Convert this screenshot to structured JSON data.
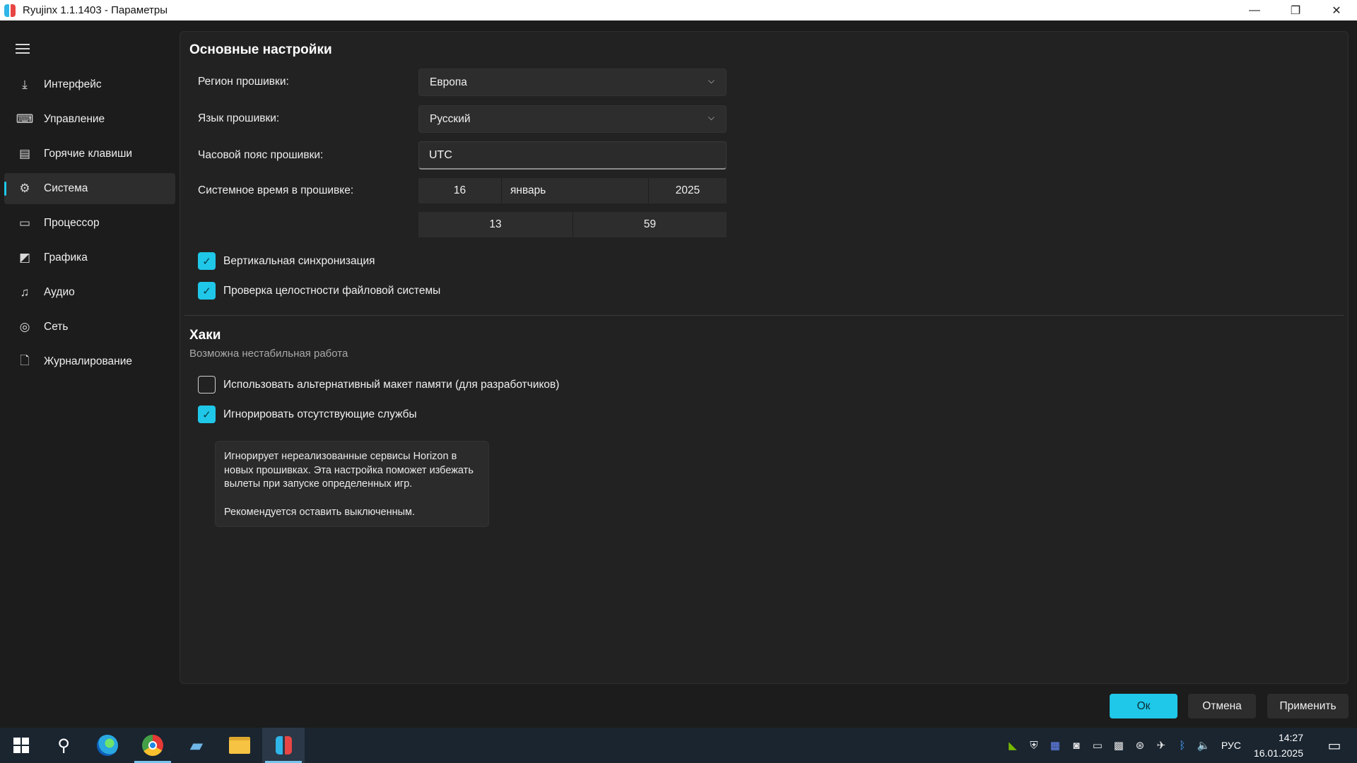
{
  "window": {
    "title": "Ryujinx 1.1.1403 - Параметры",
    "minimize": "—",
    "maximize": "❐",
    "close": "✕"
  },
  "sidebar": {
    "items": [
      {
        "label": "Интерфейс",
        "icon": "interface-icon"
      },
      {
        "label": "Управление",
        "icon": "gamepad-icon"
      },
      {
        "label": "Горячие клавиши",
        "icon": "keyboard-icon"
      },
      {
        "label": "Система",
        "icon": "gear-icon",
        "active": true
      },
      {
        "label": "Процессор",
        "icon": "cpu-icon"
      },
      {
        "label": "Графика",
        "icon": "image-icon"
      },
      {
        "label": "Аудио",
        "icon": "music-icon"
      },
      {
        "label": "Сеть",
        "icon": "globe-icon"
      },
      {
        "label": "Журналирование",
        "icon": "document-icon"
      }
    ]
  },
  "main": {
    "section_title": "Основные настройки",
    "region_label": "Регион прошивки:",
    "region_value": "Европа",
    "language_label": "Язык прошивки:",
    "language_value": "Русский",
    "timezone_label": "Часовой пояс прошивки:",
    "timezone_value": "UTC",
    "systime_label": "Системное время в прошивке:",
    "date_day": "16",
    "date_month": "январь",
    "date_year": "2025",
    "time_hour": "13",
    "time_minute": "59",
    "vsync_label": "Вертикальная синхронизация",
    "vsync_checked": true,
    "fscheck_label": "Проверка целостности файловой системы",
    "fscheck_checked": true
  },
  "hacks": {
    "title": "Хаки",
    "subtitle": "Возможна нестабильная работа",
    "altmem_label": "Использовать альтернативный макет памяти (для разработчиков)",
    "altmem_checked": false,
    "ignore_label": "Игнорировать отсутствующие службы",
    "ignore_checked": true,
    "tooltip_line1": "Игнорирует нереализованные сервисы Horizon в новых прошивках. Эта настройка поможет избежать вылеты при запуске определенных игр.",
    "tooltip_line2": "Рекомендуется оставить выключенным."
  },
  "buttons": {
    "ok": "Ок",
    "cancel": "Отмена",
    "apply": "Применить"
  },
  "taskbar": {
    "language": "РУС",
    "time": "14:27",
    "date": "16.01.2025"
  },
  "colors": {
    "accent": "#1fc7e8",
    "background": "#1c1c1c",
    "panel": "#222222"
  }
}
